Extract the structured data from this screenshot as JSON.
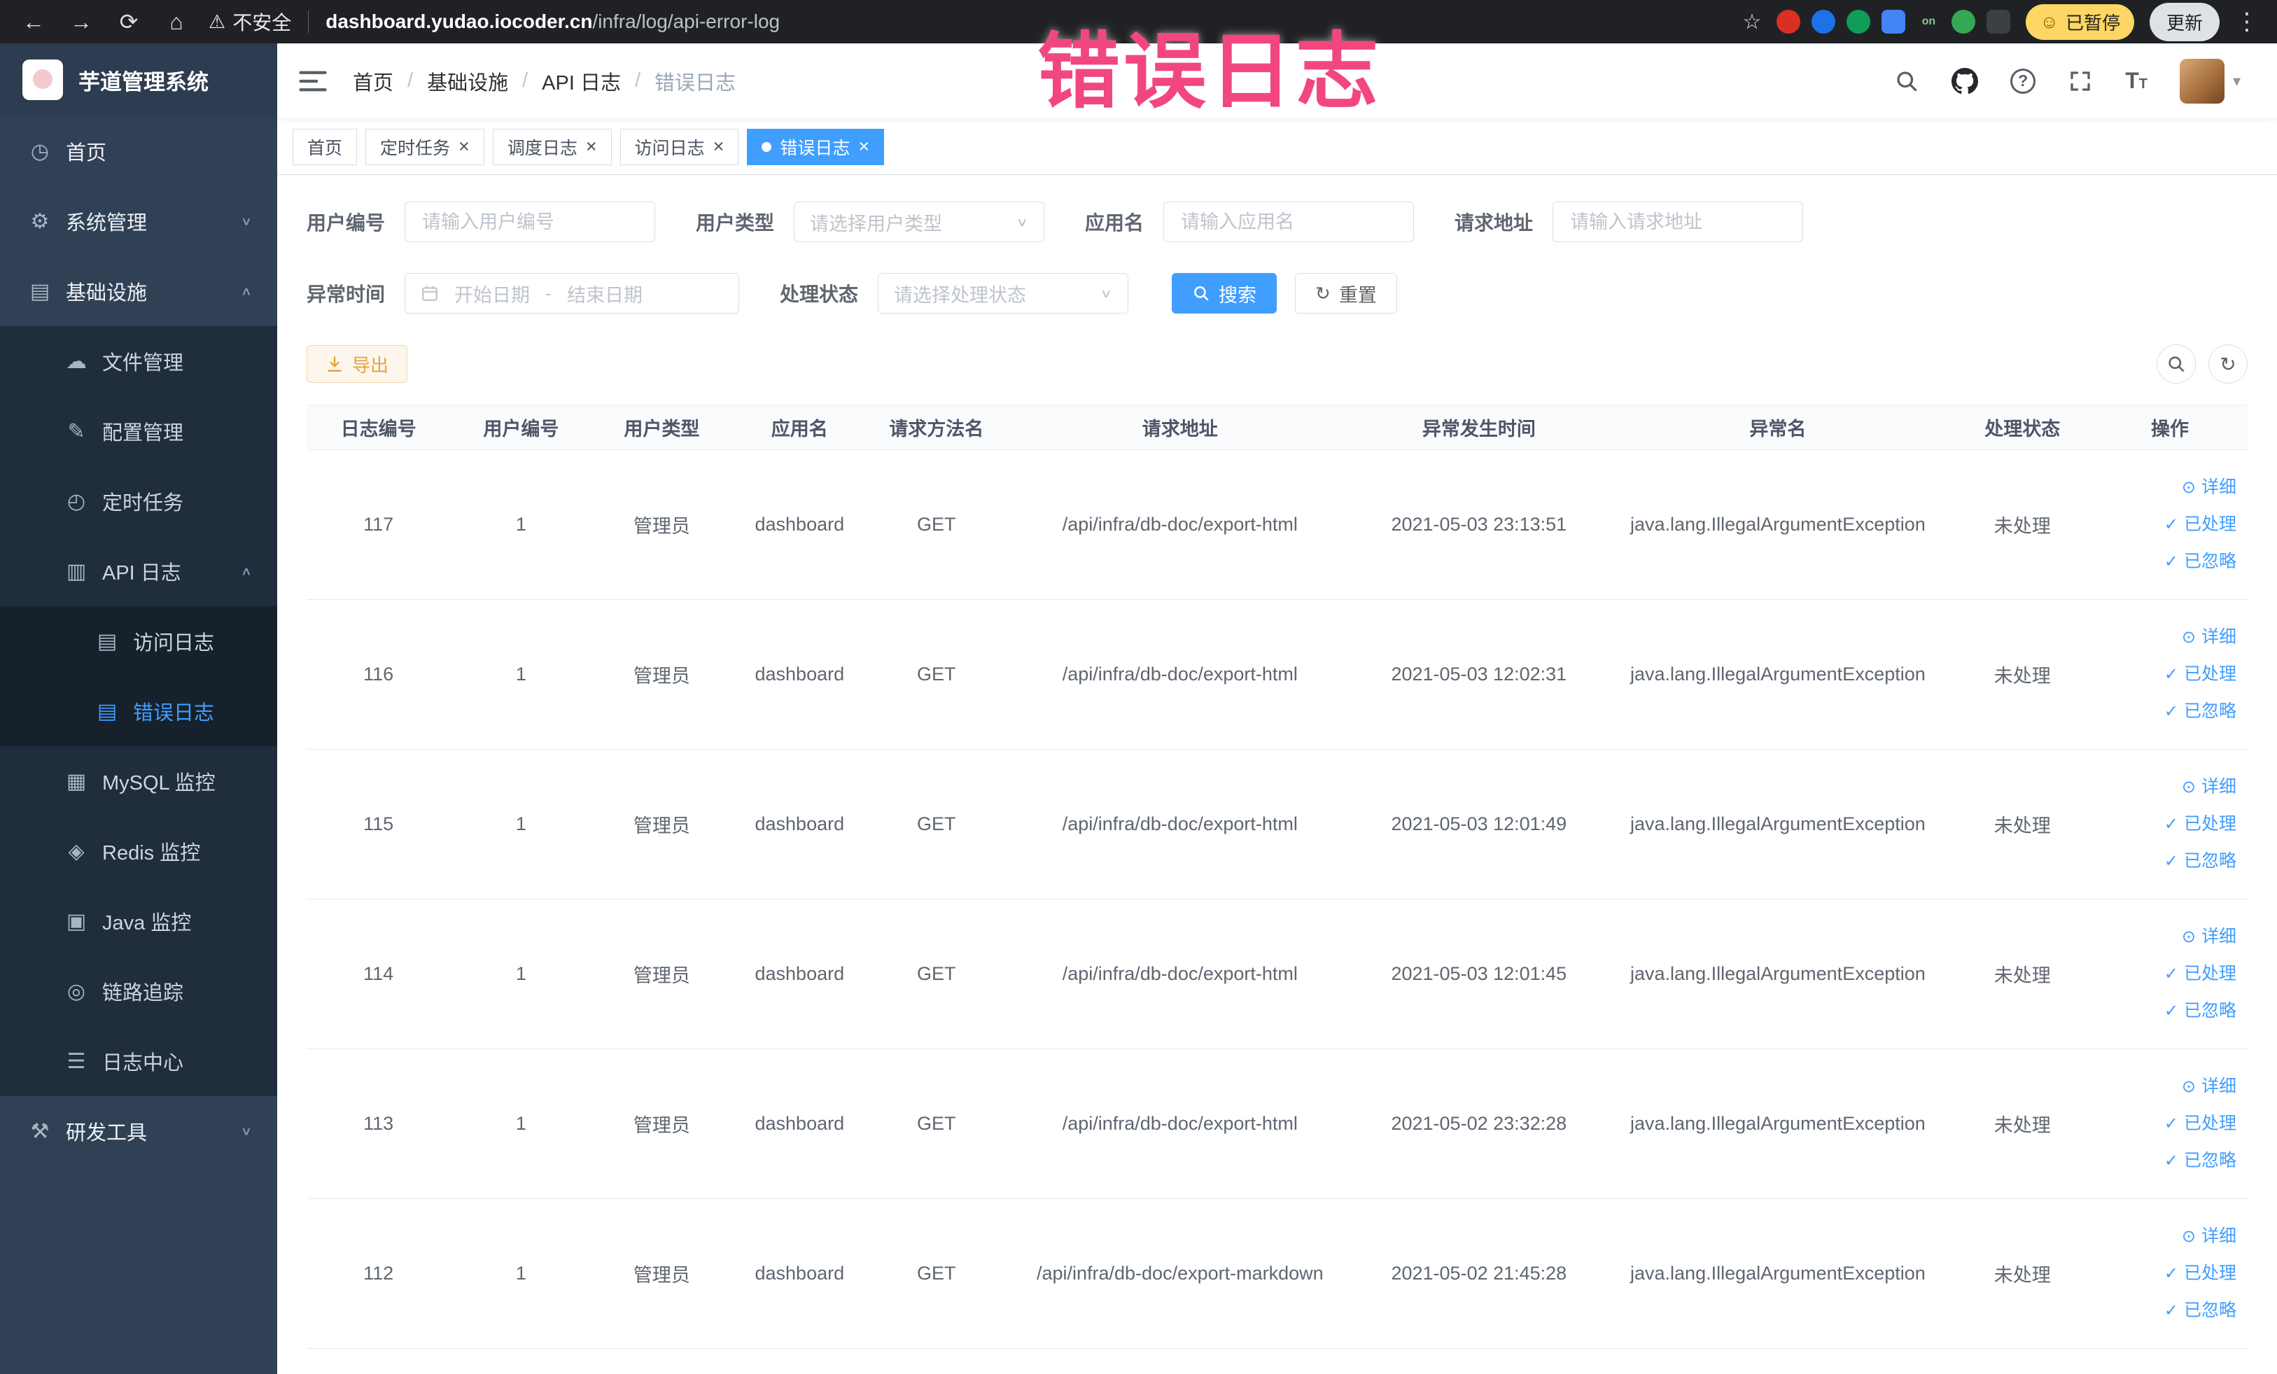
{
  "annotation": {
    "text": "错误日志",
    "color": "#f2477e"
  },
  "browser": {
    "security_label": "不安全",
    "url_domain": "dashboard.yudao.iocoder.cn",
    "url_path": "/infra/log/api-error-log",
    "paused_badge": "已暂停",
    "update_button": "更新",
    "extensions": [
      {
        "name": "extension-red-circle-icon",
        "color": "#d93025",
        "shape": "circle",
        "label": ""
      },
      {
        "name": "extension-blue-drop-icon",
        "color": "#1a73e8",
        "shape": "circle",
        "label": ""
      },
      {
        "name": "extension-green-circle-icon",
        "color": "#0f9d58",
        "shape": "circle",
        "label": ""
      },
      {
        "name": "extension-blue-grid-icon",
        "color": "#4285f4",
        "shape": "square",
        "label": ""
      },
      {
        "name": "extension-on-badge-icon",
        "color": "#202124",
        "shape": "square",
        "label": "on"
      },
      {
        "name": "extension-green-leaf-icon",
        "color": "#34a853",
        "shape": "circle",
        "label": ""
      },
      {
        "name": "extension-puzzle-icon",
        "color": "#3c4043",
        "shape": "square",
        "label": ""
      }
    ]
  },
  "sidebar": {
    "logo_title": "芋道管理系统",
    "menu": [
      {
        "name": "sidebar-item-home",
        "label": "首页",
        "icon": "dashboard-icon",
        "level": 1
      },
      {
        "name": "sidebar-item-system",
        "label": "系统管理",
        "icon": "gear-icon",
        "level": 1,
        "chevron": "down"
      },
      {
        "name": "sidebar-item-infra",
        "label": "基础设施",
        "icon": "infra-icon",
        "level": 1,
        "chevron": "up"
      },
      {
        "name": "sidebar-item-file",
        "label": "文件管理",
        "icon": "file-icon",
        "level": 2
      },
      {
        "name": "sidebar-item-config",
        "label": "配置管理",
        "icon": "config-icon",
        "level": 2
      },
      {
        "name": "sidebar-item-job",
        "label": "定时任务",
        "icon": "cron-icon",
        "level": 2
      },
      {
        "name": "sidebar-item-api-log",
        "label": "API 日志",
        "icon": "api-log-icon",
        "level": 2,
        "chevron": "up"
      },
      {
        "name": "sidebar-item-access-log",
        "label": "访问日志",
        "icon": "access-log-icon",
        "level": 3
      },
      {
        "name": "sidebar-item-error-log",
        "label": "错误日志",
        "icon": "error-log-icon",
        "level": 3,
        "active": true
      },
      {
        "name": "sidebar-item-mysql",
        "label": "MySQL 监控",
        "icon": "mysql-icon",
        "level": 2
      },
      {
        "name": "sidebar-item-redis",
        "label": "Redis 监控",
        "icon": "redis-icon",
        "level": 2
      },
      {
        "name": "sidebar-item-java",
        "label": "Java 监控",
        "icon": "java-icon",
        "level": 2
      },
      {
        "name": "sidebar-item-trace",
        "label": "链路追踪",
        "icon": "trace-icon",
        "level": 2
      },
      {
        "name": "sidebar-item-log-center",
        "label": "日志中心",
        "icon": "log-center-icon",
        "level": 2
      },
      {
        "name": "sidebar-item-devtools",
        "label": "研发工具",
        "icon": "tools-icon",
        "level": 1,
        "chevron": "down"
      }
    ]
  },
  "header": {
    "breadcrumb": [
      "首页",
      "基础设施",
      "API 日志",
      "错误日志"
    ]
  },
  "tabs": [
    {
      "name": "tab-home",
      "label": "首页",
      "closable": false,
      "active": false
    },
    {
      "name": "tab-scheduled-job",
      "label": "定时任务",
      "closable": true,
      "active": false
    },
    {
      "name": "tab-job-log",
      "label": "调度日志",
      "closable": true,
      "active": false
    },
    {
      "name": "tab-access-log",
      "label": "访问日志",
      "closable": true,
      "active": false
    },
    {
      "name": "tab-error-log",
      "label": "错误日志",
      "closable": true,
      "active": true
    }
  ],
  "filters": {
    "user_id": {
      "label": "用户编号",
      "placeholder": "请输入用户编号"
    },
    "user_type": {
      "label": "用户类型",
      "placeholder": "请选择用户类型"
    },
    "app_name": {
      "label": "应用名",
      "placeholder": "请输入应用名"
    },
    "request_url": {
      "label": "请求地址",
      "placeholder": "请输入请求地址"
    },
    "exception_time": {
      "label": "异常时间",
      "start_placeholder": "开始日期",
      "separator": "-",
      "end_placeholder": "结束日期"
    },
    "process_status": {
      "label": "处理状态",
      "placeholder": "请选择处理状态"
    },
    "search_button": "搜索",
    "reset_button": "重置"
  },
  "toolbar": {
    "export_button": "导出"
  },
  "table": {
    "columns": [
      "日志编号",
      "用户编号",
      "用户类型",
      "应用名",
      "请求方法名",
      "请求地址",
      "异常发生时间",
      "异常名",
      "处理状态",
      "操作"
    ],
    "actions": {
      "detail": "详细",
      "processed": "已处理",
      "ignored": "已忽略"
    },
    "rows": [
      {
        "id": "117",
        "user_id": "1",
        "user_type": "管理员",
        "app": "dashboard",
        "method": "GET",
        "url": "/api/infra/db-doc/export-html",
        "time": "2021-05-03 23:13:51",
        "exception": "java.lang.IllegalArgumentException",
        "status": "未处理"
      },
      {
        "id": "116",
        "user_id": "1",
        "user_type": "管理员",
        "app": "dashboard",
        "method": "GET",
        "url": "/api/infra/db-doc/export-html",
        "time": "2021-05-03 12:02:31",
        "exception": "java.lang.IllegalArgumentException",
        "status": "未处理"
      },
      {
        "id": "115",
        "user_id": "1",
        "user_type": "管理员",
        "app": "dashboard",
        "method": "GET",
        "url": "/api/infra/db-doc/export-html",
        "time": "2021-05-03 12:01:49",
        "exception": "java.lang.IllegalArgumentException",
        "status": "未处理"
      },
      {
        "id": "114",
        "user_id": "1",
        "user_type": "管理员",
        "app": "dashboard",
        "method": "GET",
        "url": "/api/infra/db-doc/export-html",
        "time": "2021-05-03 12:01:45",
        "exception": "java.lang.IllegalArgumentException",
        "status": "未处理"
      },
      {
        "id": "113",
        "user_id": "1",
        "user_type": "管理员",
        "app": "dashboard",
        "method": "GET",
        "url": "/api/infra/db-doc/export-html",
        "time": "2021-05-02 23:32:28",
        "exception": "java.lang.IllegalArgumentException",
        "status": "未处理"
      },
      {
        "id": "112",
        "user_id": "1",
        "user_type": "管理员",
        "app": "dashboard",
        "method": "GET",
        "url": "/api/infra/db-doc/export-markdown",
        "time": "2021-05-02 21:45:28",
        "exception": "java.lang.IllegalArgumentException",
        "status": "未处理"
      }
    ]
  },
  "colors": {
    "primary": "#409eff",
    "warning": "#e6a23c",
    "sidebar_bg": "#304156",
    "submenu_bg": "#1f2d3d",
    "annotation": "#f2477e"
  }
}
